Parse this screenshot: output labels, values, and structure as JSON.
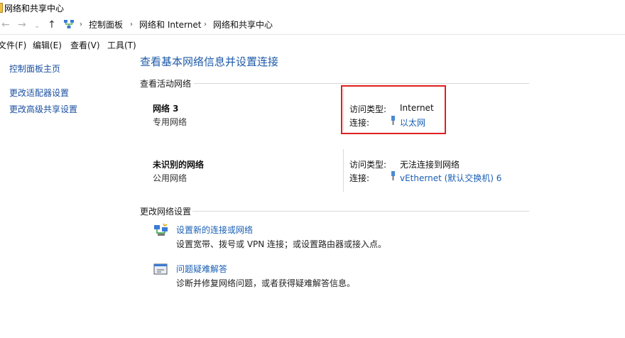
{
  "window": {
    "title": "网络和共享中心"
  },
  "breadcrumb": [
    "控制面板",
    "网络和 Internet",
    "网络和共享中心"
  ],
  "menu": [
    "文件(F)",
    "编辑(E)",
    "查看(V)",
    "工具(T)"
  ],
  "sidebar": {
    "links": [
      "控制面板主页",
      "更改适配器设置",
      "更改高级共享设置"
    ]
  },
  "main": {
    "title": "查看基本网络信息并设置连接",
    "active_section": "查看活动网络",
    "networks": [
      {
        "name": "网络 3",
        "type": "专用网络",
        "access_label": "访问类型:",
        "access_value": "Internet",
        "conn_label": "连接:",
        "conn_value": "以太网"
      },
      {
        "name": "未识别的网络",
        "type": "公用网络",
        "access_label": "访问类型:",
        "access_value": "无法连接到网络",
        "conn_label": "连接:",
        "conn_value": "vEthernet (默认交换机) 6"
      }
    ],
    "change_section": "更改网络设置",
    "tasks": [
      {
        "link": "设置新的连接或网络",
        "desc": "设置宽带、拨号或 VPN 连接；或设置路由器或接入点。"
      },
      {
        "link": "问题疑难解答",
        "desc": "诊断并修复网络问题，或者获得疑难解答信息。"
      }
    ]
  },
  "colors": {
    "link": "#1a5fb4",
    "title": "#1e5aa8",
    "highlight": "#e02020"
  }
}
